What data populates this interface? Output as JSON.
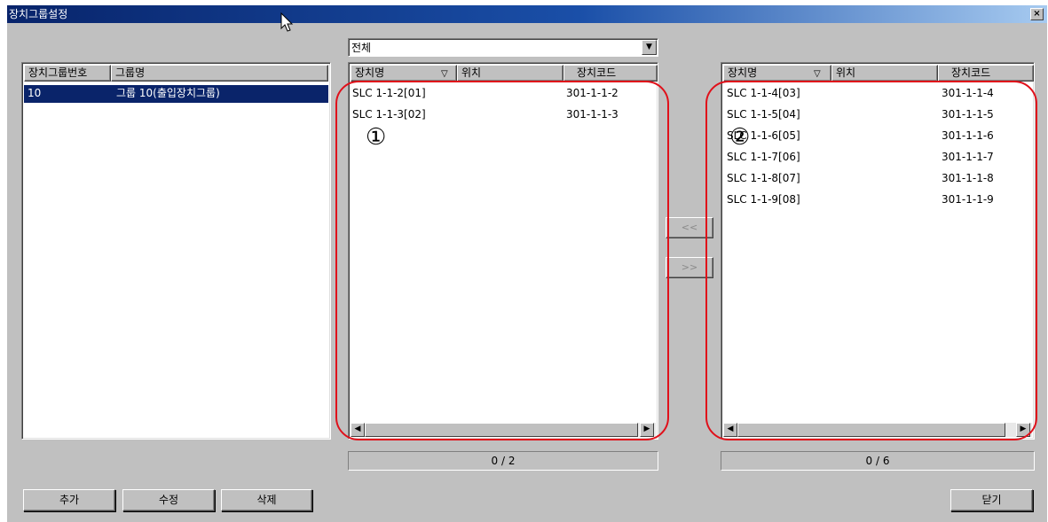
{
  "window": {
    "title": "장치그룹설정",
    "close_label": "×"
  },
  "group_table": {
    "columns": [
      "장치그룹번호",
      "그룹명"
    ],
    "rows": [
      {
        "number": "10",
        "name": "그룹 10(출입장치그룹)",
        "selected": true
      }
    ]
  },
  "filter": {
    "selected": "전체",
    "arrow": "▼"
  },
  "device_columns": {
    "name": "장치명",
    "sort_mark": "▽",
    "location": "위치",
    "code": "장치코드"
  },
  "left_list": {
    "rows": [
      {
        "name": "SLC 1-1-2[01]",
        "location": "",
        "code": "301-1-1-2"
      },
      {
        "name": "SLC 1-1-3[02]",
        "location": "",
        "code": "301-1-1-3"
      }
    ],
    "counter": "0 / 2",
    "annotation": "①"
  },
  "right_list": {
    "rows": [
      {
        "name": "SLC 1-1-4[03]",
        "location": "",
        "code": "301-1-1-4"
      },
      {
        "name": "SLC 1-1-5[04]",
        "location": "",
        "code": "301-1-1-5"
      },
      {
        "name": "SLC 1-1-6[05]",
        "location": "",
        "code": "301-1-1-6"
      },
      {
        "name": "SLC 1-1-7[06]",
        "location": "",
        "code": "301-1-1-7"
      },
      {
        "name": "SLC 1-1-8[07]",
        "location": "",
        "code": "301-1-1-8"
      },
      {
        "name": "SLC 1-1-9[08]",
        "location": "",
        "code": "301-1-1-9"
      }
    ],
    "counter": "0 / 6",
    "annotation": "②"
  },
  "move_buttons": {
    "move_left": "<<",
    "move_right": ">>"
  },
  "scroll_arrows": {
    "left": "◀",
    "right": "▶"
  },
  "actions": {
    "add": "추가",
    "edit": "수정",
    "delete": "삭제",
    "close": "닫기"
  }
}
